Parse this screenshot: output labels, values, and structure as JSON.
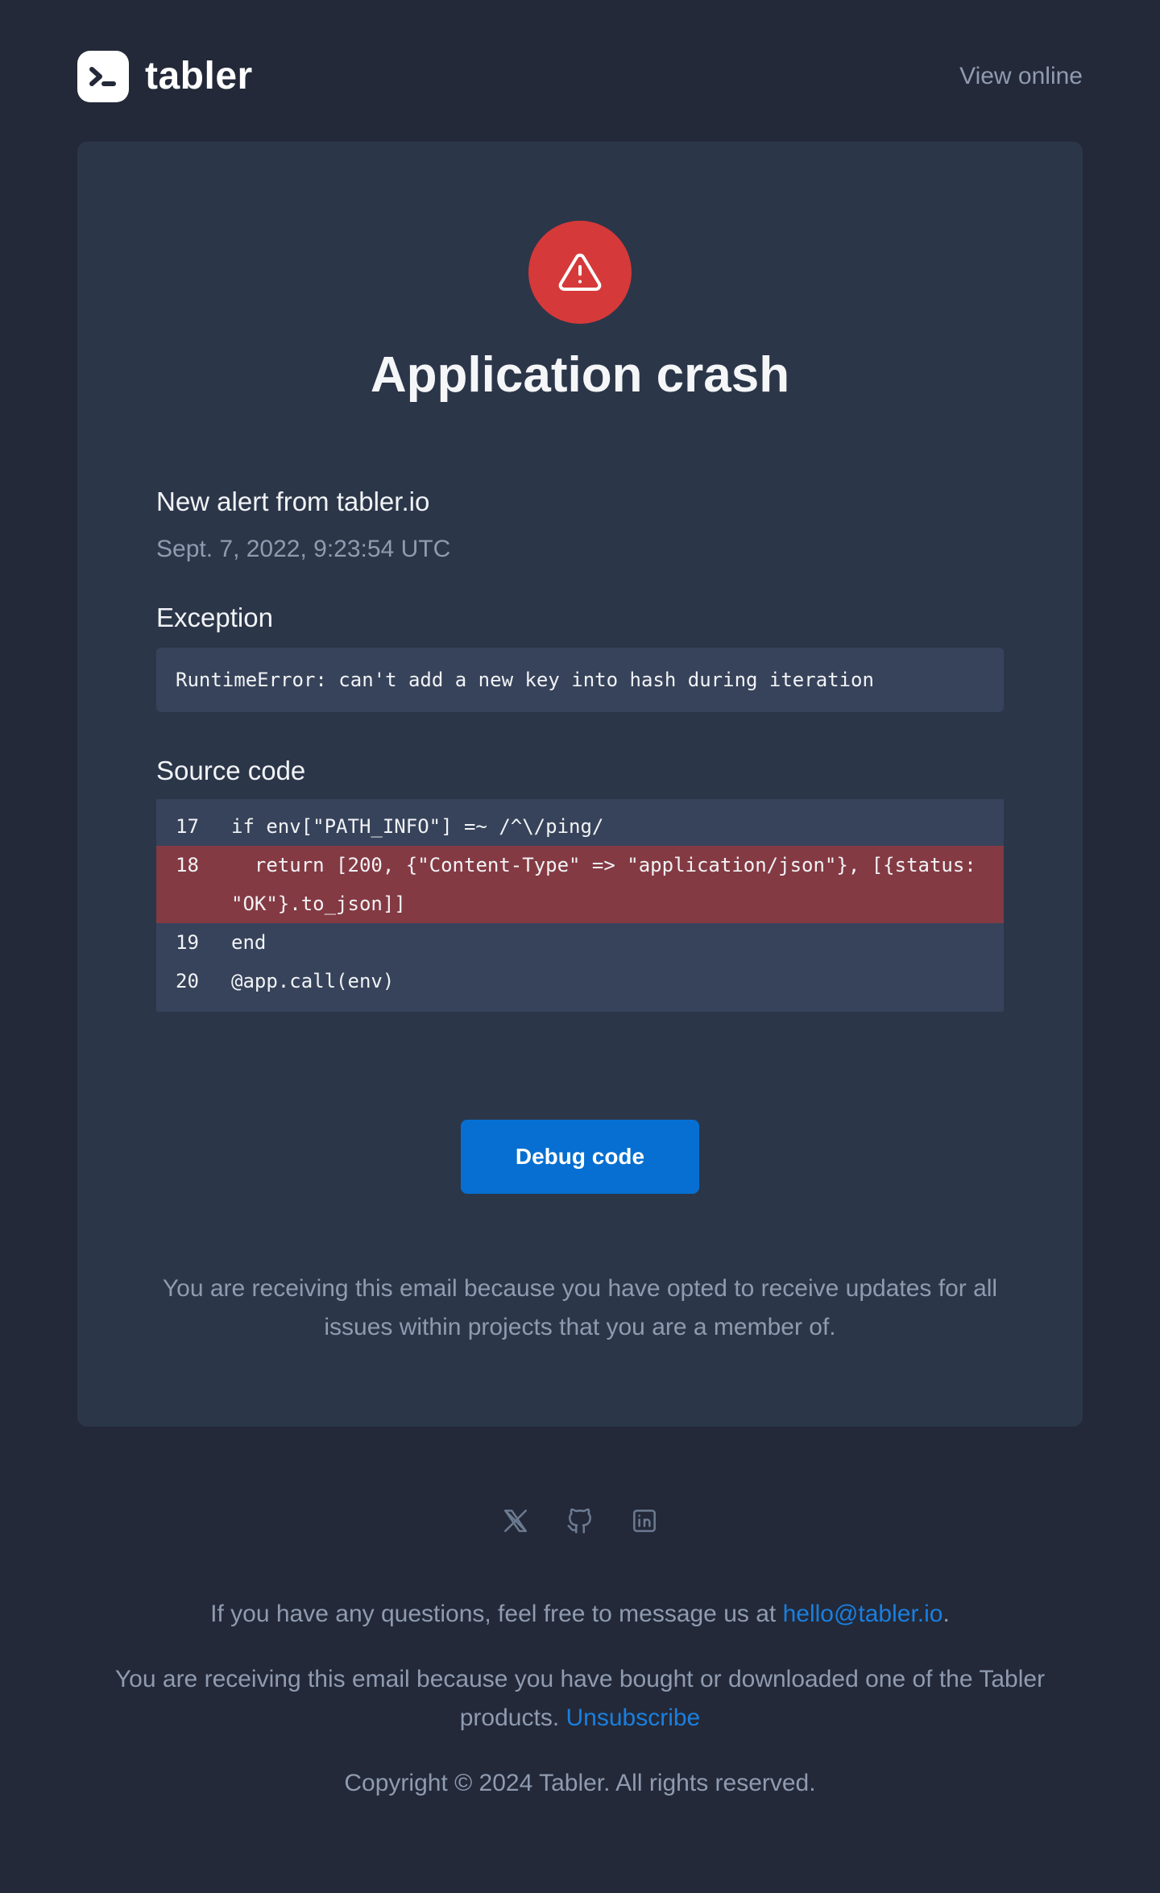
{
  "header": {
    "brand": "tabler",
    "view_online": "View online"
  },
  "alert": {
    "icon": "alert-triangle-icon",
    "title": "Application crash",
    "subhead": "New alert from tabler.io",
    "date": "Sept. 7, 2022, 9:23:54 UTC",
    "exception_label": "Exception",
    "exception_text": "RuntimeError: can't add a new key into hash during iteration",
    "source_label": "Source code",
    "code_lines": [
      {
        "number": "17",
        "text": "if env[\"PATH_INFO\"] =~ /^\\/ping/",
        "highlighted": false
      },
      {
        "number": "18",
        "text": "  return [200, {\"Content-Type\" => \"application/json\"}, [{status: \"OK\"}.to_json]]",
        "highlighted": true
      },
      {
        "number": "19",
        "text": "end",
        "highlighted": false
      },
      {
        "number": "20",
        "text": "@app.call(env)",
        "highlighted": false
      }
    ],
    "button_label": "Debug code",
    "note": "You are receiving this email because you have opted to receive updates for all issues within projects that you are a member of."
  },
  "footer": {
    "social": [
      "x-icon",
      "github-icon",
      "linkedin-icon"
    ],
    "questions_prefix": "If you have any questions, feel free to message us at ",
    "email": "hello@tabler.io",
    "questions_suffix": ".",
    "reason_prefix": "You are receiving this email because you have bought or downloaded one of the Tabler products. ",
    "unsubscribe": "Unsubscribe",
    "copyright": "Copyright © 2024 Tabler. All rights reserved."
  },
  "colors": {
    "background": "#232938",
    "card": "#2c3649",
    "code_bg": "#37435a",
    "highlight": "#843a43",
    "danger": "#d63939",
    "primary": "#066fd1",
    "muted": "#8f9bb0"
  }
}
